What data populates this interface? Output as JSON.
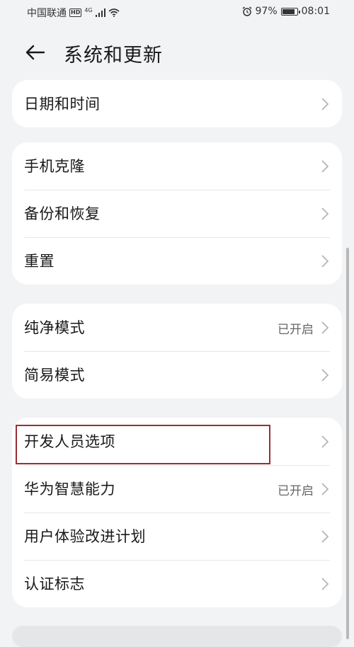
{
  "status_bar": {
    "carrier": "中国联通",
    "hd": "HD",
    "network": "4G",
    "battery": "97%",
    "battery_level": 0.97,
    "time": "08:01"
  },
  "header": {
    "title": "系统和更新"
  },
  "groups": [
    {
      "items": [
        {
          "label": "日期和时间"
        }
      ]
    },
    {
      "items": [
        {
          "label": "手机克隆"
        },
        {
          "label": "备份和恢复"
        },
        {
          "label": "重置"
        }
      ]
    },
    {
      "items": [
        {
          "label": "纯净模式",
          "status": "已开启"
        },
        {
          "label": "简易模式"
        }
      ]
    },
    {
      "items": [
        {
          "label": "开发人员选项"
        },
        {
          "label": "华为智慧能力",
          "status": "已开启"
        },
        {
          "label": "用户体验改进计划"
        },
        {
          "label": "认证标志"
        }
      ]
    }
  ],
  "colors": {
    "background": "#f1f3f5",
    "card": "#ffffff",
    "highlight": "#9b2d35"
  }
}
